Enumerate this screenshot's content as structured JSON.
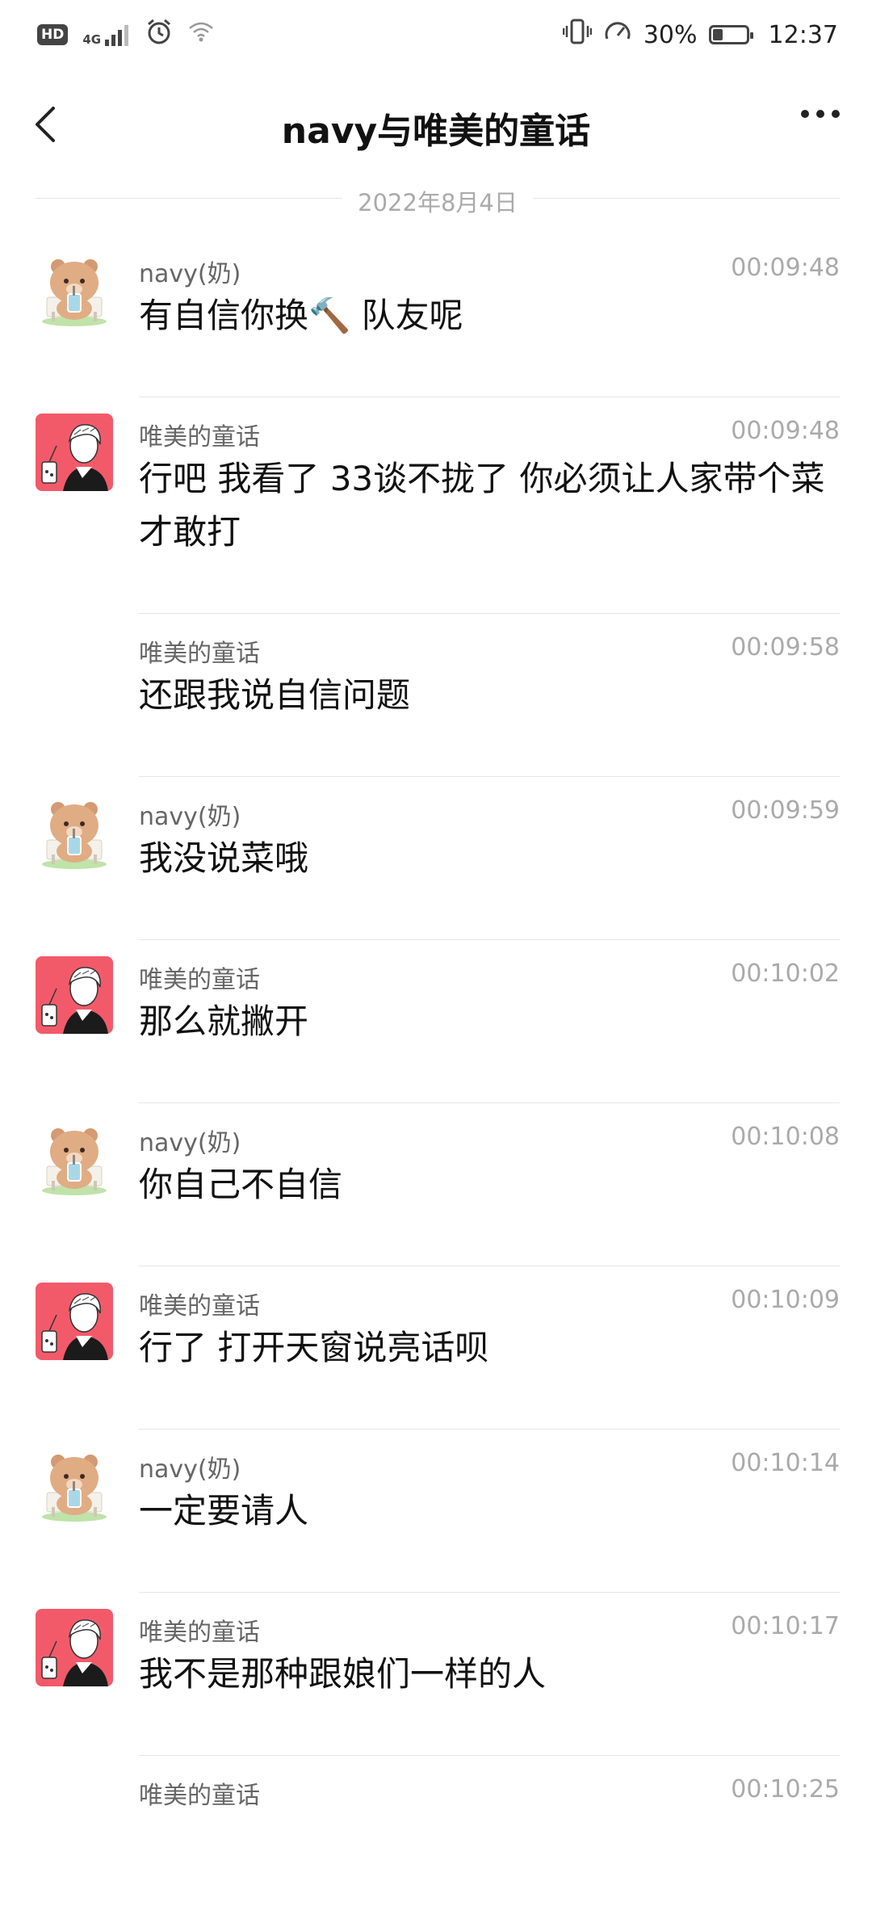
{
  "status_bar": {
    "hd": "HD",
    "network": "4G",
    "battery_percent": "30%",
    "battery_level": 0.3,
    "time": "12:37"
  },
  "header": {
    "title": "navy与唯美的童话"
  },
  "date_divider": "2022年8月4日",
  "avatars": {
    "navy": "bear-avatar",
    "weimei": "person-avatar"
  },
  "messages": [
    {
      "sender": "navy(奶)",
      "time": "00:09:48",
      "text": "有自信你换🔨 队友呢",
      "avatar": "navy"
    },
    {
      "sender": "唯美的童话",
      "time": "00:09:48",
      "text": "行吧 我看了 33谈不拢了 你必须让人家带个菜才敢打",
      "avatar": "weimei"
    },
    {
      "sender": "唯美的童话",
      "time": "00:09:58",
      "text": "还跟我说自信问题",
      "avatar": ""
    },
    {
      "sender": "navy(奶)",
      "time": "00:09:59",
      "text": "我没说菜哦",
      "avatar": "navy"
    },
    {
      "sender": "唯美的童话",
      "time": "00:10:02",
      "text": "那么就撇开",
      "avatar": "weimei"
    },
    {
      "sender": "navy(奶)",
      "time": "00:10:08",
      "text": "你自己不自信",
      "avatar": "navy"
    },
    {
      "sender": "唯美的童话",
      "time": "00:10:09",
      "text": "行了 打开天窗说亮话呗",
      "avatar": "weimei"
    },
    {
      "sender": "navy(奶)",
      "time": "00:10:14",
      "text": "一定要请人",
      "avatar": "navy"
    },
    {
      "sender": "唯美的童话",
      "time": "00:10:17",
      "text": "我不是那种跟娘们一样的人",
      "avatar": "weimei"
    },
    {
      "sender": "唯美的童话",
      "time": "00:10:25",
      "text": "",
      "avatar": ""
    }
  ]
}
